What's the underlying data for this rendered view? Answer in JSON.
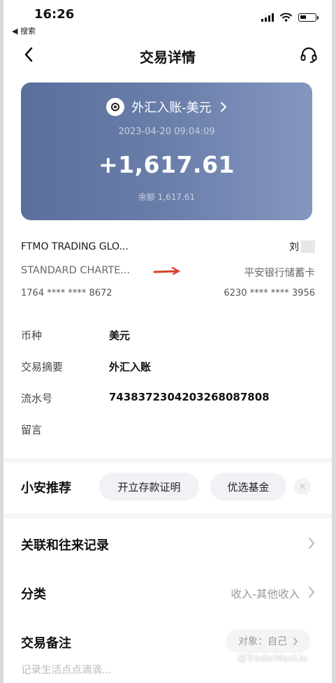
{
  "status_bar": {
    "time": "16:26",
    "back_app": "◀ 搜索"
  },
  "nav": {
    "title": "交易详情"
  },
  "card": {
    "type_label": "外汇入账-美元",
    "date": "2023-04-20 09:04:09",
    "amount": "+1,617.61",
    "balance": "余额 1,617.61",
    "colors": {
      "start": "#5b6f9c",
      "end": "#8497c1"
    }
  },
  "from": {
    "name": "FTMO TRADING GLO...",
    "bank": "STANDARD CHARTE...",
    "account": "1764 **** **** 8672"
  },
  "to": {
    "name": "刘",
    "bank": "平安银行储蓄卡",
    "account": "6230 **** **** 3956"
  },
  "details": [
    {
      "label": "币种",
      "value": "美元"
    },
    {
      "label": "交易摘要",
      "value": "外汇入账"
    },
    {
      "label": "流水号",
      "value": "743837230420326808780​8"
    },
    {
      "label": "留言",
      "value": ""
    }
  ],
  "recommend": {
    "title": "小安推荐",
    "chips": [
      "开立存款证明",
      "优选基金"
    ],
    "close": "×"
  },
  "lower": {
    "related": "关联和往来记录",
    "category_label": "分类",
    "category_value": "收入-其他收入",
    "note_label": "交易备注",
    "object_label": "对象：自己",
    "note_placeholder": "记录生活点点滴滴..."
  },
  "watermark": "@TraderMaxLiu",
  "accent_arrow_color": "#d9412c"
}
